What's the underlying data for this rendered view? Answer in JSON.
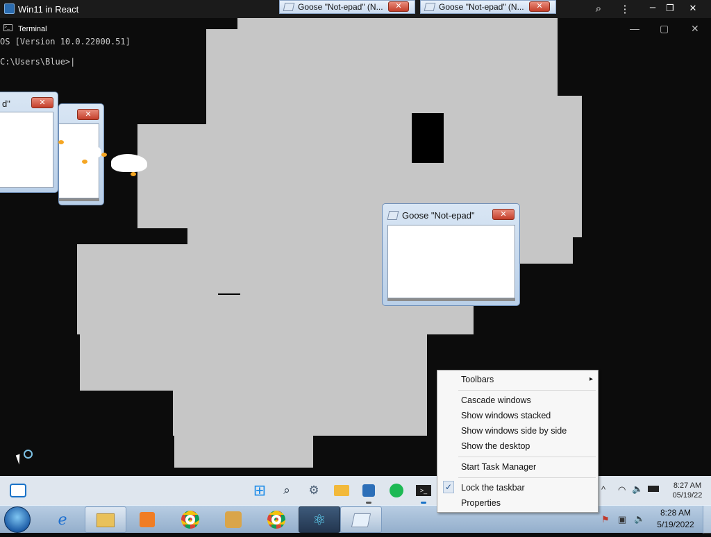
{
  "app": {
    "title": "Win11 in React"
  },
  "top_tabs": [
    {
      "label": "Goose \"Not-epad\" (N...",
      "close": "✕"
    },
    {
      "label": "Goose \"Not-epad\" (N...",
      "close": "✕"
    }
  ],
  "top_icons": {
    "zoom": "⌕",
    "menu": "⋮",
    "min": "–",
    "restore": "❐",
    "close": "✕"
  },
  "terminal": {
    "title": "Terminal",
    "line1": "OS [Version 10.0.22000.51]",
    "line2": "C:\\Users\\Blue>",
    "controls": {
      "min": "—",
      "max": "▢",
      "close": "✕"
    }
  },
  "notepads": [
    {
      "title": "d\"",
      "close": "✕"
    },
    {
      "title": "",
      "close": "✕"
    },
    {
      "title": "Goose \"Not-epad\"",
      "close": "✕"
    }
  ],
  "context_menu": {
    "items": [
      {
        "label": "Toolbars",
        "submenu": true
      },
      {
        "label": "Cascade windows"
      },
      {
        "label": "Show windows stacked"
      },
      {
        "label": "Show windows side by side"
      },
      {
        "label": "Show the desktop"
      },
      {
        "label": "Start Task Manager"
      },
      {
        "label": "Lock the taskbar",
        "checked": true
      },
      {
        "label": "Properties"
      }
    ],
    "check_glyph": "✓",
    "submenu_glyph": "▸"
  },
  "taskbar11": {
    "icons": [
      "widgets-icon",
      "start-icon",
      "search-icon",
      "settings-icon",
      "folder-icon",
      "store-icon",
      "spotify-icon",
      "terminal-icon"
    ],
    "tray_chevron": "^",
    "time": "8:27 AM",
    "date": "05/19/22"
  },
  "taskbar7": {
    "icons": [
      "start-orb",
      "ie-icon",
      "explorer-icon",
      "media-player-icon",
      "chrome-icon",
      "paint-icon",
      "chrome-icon",
      "react-icon",
      "notepad-icon"
    ],
    "time": "8:28 AM",
    "date": "5/19/2022"
  },
  "colors": {
    "accent": "#2b6cb0",
    "grey_block": "#c6c6c6",
    "taskbar11": "#dfe6ee",
    "taskbar7": "#a6bed8"
  }
}
